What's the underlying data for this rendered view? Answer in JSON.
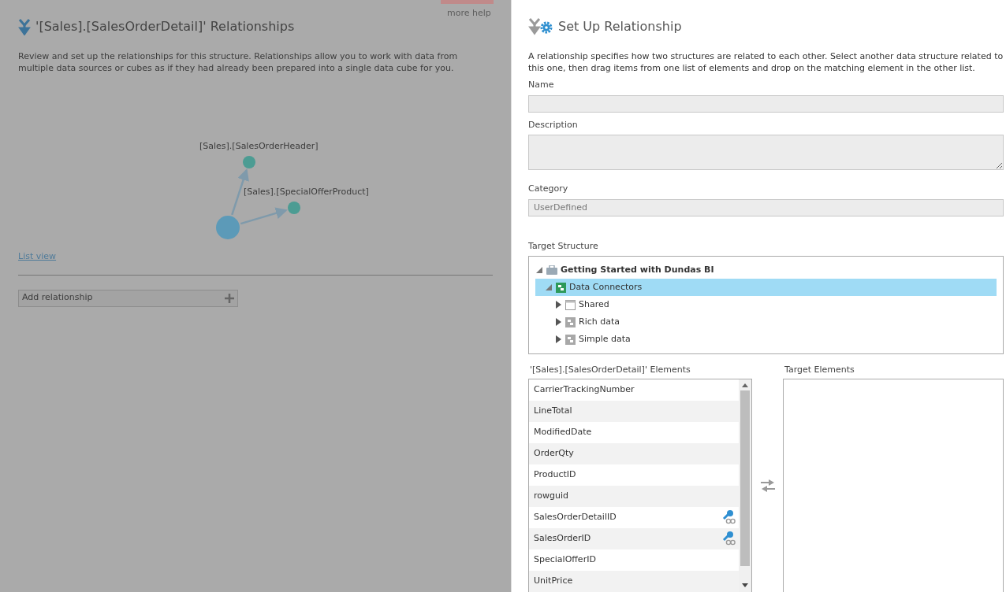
{
  "left_panel": {
    "more_help": "more help",
    "title": "'[Sales].[SalesOrderDetail]' Relationships",
    "description": "Review and set up the relationships for this structure. Relationships allow you to work with data from multiple data sources or cubes as if they had already been prepared into a single data cube for you.",
    "graph": {
      "nodes": [
        {
          "label": "[Sales].[SalesOrderHeader]",
          "kind": "related"
        },
        {
          "label": "[Sales].[SpecialOfferProduct]",
          "kind": "related"
        }
      ]
    },
    "list_view_link": "List view",
    "add_button": "Add relationship"
  },
  "dialog": {
    "title": "Set Up Relationship",
    "description": "A relationship specifies how two structures are related to each other. Select another data structure related to this one, then drag items from one list of elements and drop on the matching element in the other list.",
    "name": {
      "label": "Name"
    },
    "description_field": {
      "label": "Description"
    },
    "category": {
      "label": "Category",
      "value": "UserDefined"
    },
    "target_structure": {
      "label": "Target Structure",
      "tree": [
        {
          "label": "Getting Started with Dundas BI",
          "kind": "project",
          "expanded": true,
          "selected": false,
          "children": [
            {
              "label": "Data Connectors",
              "kind": "connectors",
              "expanded": true,
              "selected": true,
              "children": [
                {
                  "label": "Shared",
                  "kind": "folder",
                  "expanded": false,
                  "selected": false
                },
                {
                  "label": "Rich data",
                  "kind": "connectors-grey",
                  "expanded": false,
                  "selected": false
                },
                {
                  "label": "Simple data",
                  "kind": "connectors-grey",
                  "expanded": false,
                  "selected": false
                }
              ]
            }
          ]
        }
      ]
    },
    "source_elements": {
      "label": "'[Sales].[SalesOrderDetail]' Elements",
      "items": [
        {
          "label": "CarrierTrackingNumber",
          "key": false
        },
        {
          "label": "LineTotal",
          "key": false
        },
        {
          "label": "ModifiedDate",
          "key": false
        },
        {
          "label": "OrderQty",
          "key": false
        },
        {
          "label": "ProductID",
          "key": false
        },
        {
          "label": "rowguid",
          "key": false
        },
        {
          "label": "SalesOrderDetailID",
          "key": true
        },
        {
          "label": "SalesOrderID",
          "key": true
        },
        {
          "label": "SpecialOfferID",
          "key": false
        },
        {
          "label": "UnitPrice",
          "key": false
        }
      ]
    },
    "target_elements": {
      "label": "Target Elements"
    }
  }
}
